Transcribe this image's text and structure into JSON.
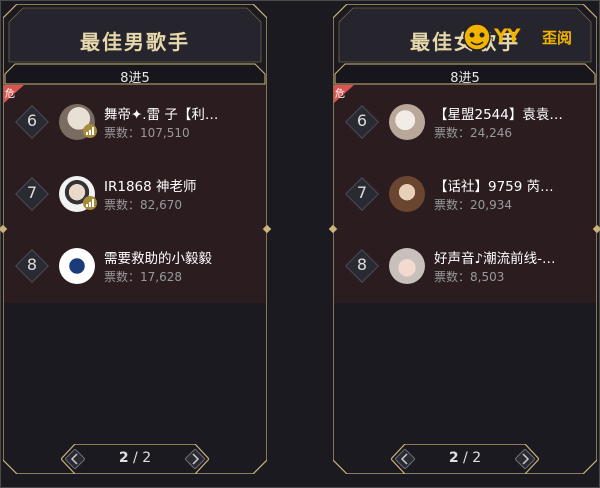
{
  "panels": [
    {
      "title": "最佳男歌手",
      "round": "8进5",
      "danger_label": "危",
      "rows": [
        {
          "rank": "6",
          "name": "舞帝✦.雷 子【利…",
          "votes": "票数：107,510"
        },
        {
          "rank": "7",
          "name": "IR1868 神老师",
          "votes": "票数：82,670"
        },
        {
          "rank": "8",
          "name": "需要救助的小毅毅",
          "votes": "票数：17,628"
        }
      ],
      "pager": {
        "current": "2",
        "separator": "/",
        "total": "2"
      }
    },
    {
      "title": "最佳女歌手",
      "round": "8进5",
      "danger_label": "危",
      "rows": [
        {
          "rank": "6",
          "name": "【星盟2544】袁袁…",
          "votes": "票数：24,246"
        },
        {
          "rank": "7",
          "name": "【话社】9759 芮…",
          "votes": "票数：20,934"
        },
        {
          "rank": "8",
          "name": "好声音♪潮流前线-…",
          "votes": "票数：8,503"
        }
      ],
      "pager": {
        "current": "2",
        "separator": "/",
        "total": "2"
      }
    }
  ],
  "brand": {
    "logo_text": "YY",
    "product_text": "歪阅"
  },
  "colors": {
    "gold": "#cdb57a",
    "title": "#e6d8aa",
    "danger": "#d9534f",
    "brand": "#f3b400",
    "level_badge": "#a78b3a"
  }
}
